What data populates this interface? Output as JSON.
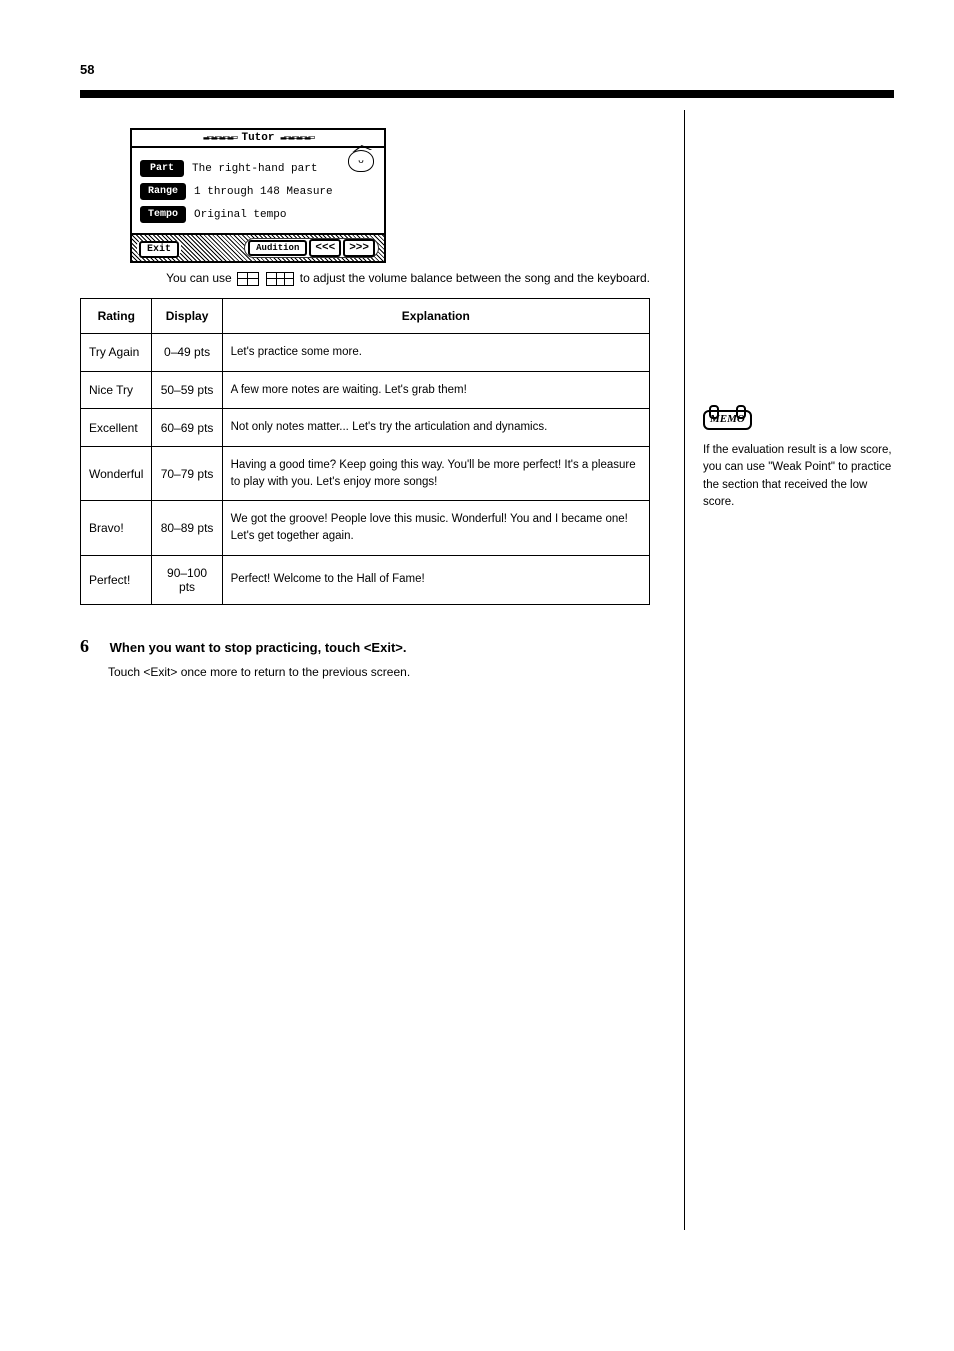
{
  "page_number": "58",
  "lcd": {
    "title": "Tutor",
    "part_btn": "Part",
    "part_value": "The right-hand part",
    "range_btn": "Range",
    "range_value": "1 through 148 Measure",
    "tempo_btn": "Tempo",
    "tempo_value": "Original tempo",
    "exit_btn": "Exit",
    "audition_btn": "Audition",
    "reverse_btn": "<<<",
    "forward_btn": ">>>"
  },
  "caption_before": "You can use ",
  "caption_after": " to adjust the volume balance between the song and the keyboard.",
  "table": {
    "headers": [
      "Rating",
      "Display",
      "Explanation"
    ],
    "rows": [
      {
        "rating": "Try Again",
        "display": "0–49 pts",
        "expl": "Let's practice some more."
      },
      {
        "rating": "Nice Try",
        "display": "50–59 pts",
        "expl": "A few more notes are waiting. Let's grab them!"
      },
      {
        "rating": "Excellent",
        "display": "60–69 pts",
        "expl": "Not only notes matter... Let's try the articulation and dynamics."
      },
      {
        "rating": "Wonderful",
        "display": "70–79 pts",
        "expl": "Having a good time? Keep going this way. You'll be more perfect!\nIt's a pleasure to play with you. Let's enjoy more songs!"
      },
      {
        "rating": "Bravo!",
        "display": "80–89 pts",
        "expl": "We got the groove! People love this music.\nWonderful! You and I became one! Let's get together again."
      },
      {
        "rating": "Perfect!",
        "display": "90–100 pts",
        "expl": "Perfect! Welcome to the Hall of Fame!"
      }
    ]
  },
  "step": {
    "num": "6",
    "text": "When you want to stop practicing, touch <Exit>.",
    "note": "Touch <Exit> once more to return to the previous screen."
  },
  "memo": {
    "label": "MEMO",
    "text": "If the evaluation result is a low score, you can use \"Weak Point\" to practice the section that received the low score."
  }
}
